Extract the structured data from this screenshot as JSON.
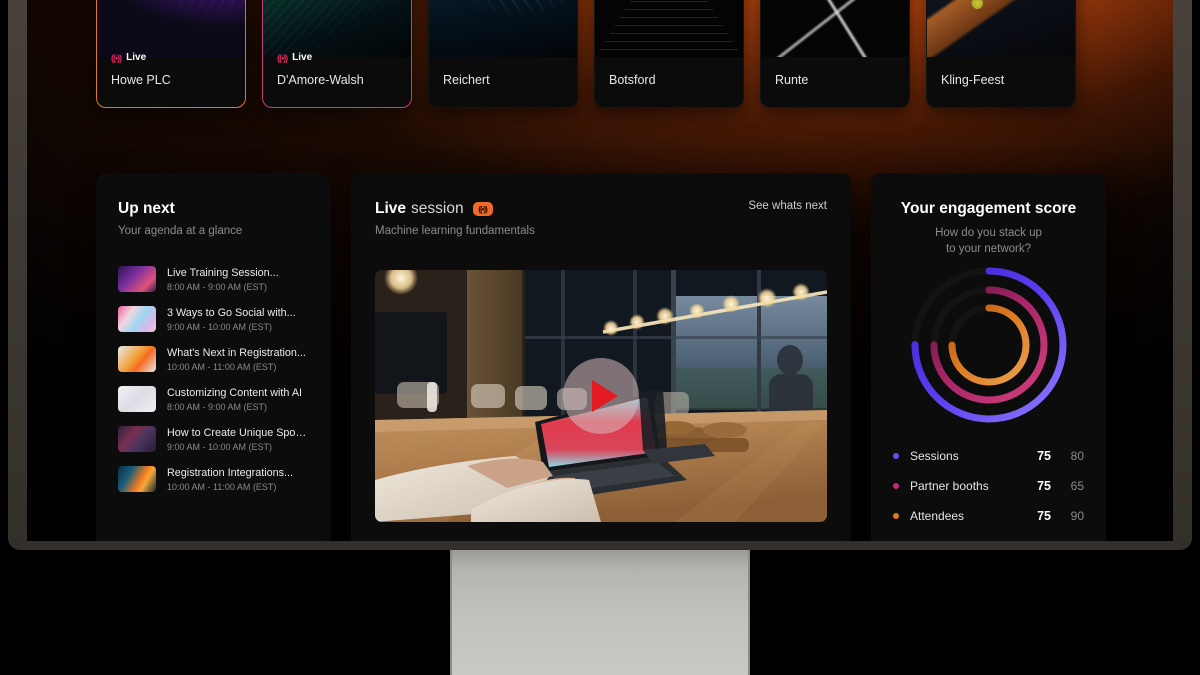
{
  "event_cards": [
    {
      "name": "Howe PLC",
      "live": true,
      "live_label": "Live",
      "avatar_icon": "glasses-face-icon",
      "highlight": "orange"
    },
    {
      "name": "D'Amore-Walsh",
      "live": true,
      "live_label": "Live",
      "avatar_icon": "bird-icon",
      "highlight": "pink"
    },
    {
      "name": "Reichert",
      "live": false,
      "live_label": "",
      "avatar_icon": "star-icon",
      "highlight": "none"
    },
    {
      "name": "Botsford",
      "live": false,
      "live_label": "",
      "avatar_icon": "leaf-icon",
      "highlight": "none"
    },
    {
      "name": "Runte",
      "live": false,
      "live_label": "",
      "avatar_icon": "smile-icon",
      "highlight": "none"
    },
    {
      "name": "Kling-Feest",
      "live": false,
      "live_label": "",
      "avatar_icon": "circle-icon",
      "highlight": "none"
    }
  ],
  "up_next": {
    "title": "Up next",
    "subtitle": "Your agenda at a glance",
    "items": [
      {
        "title": "Live Training Session...",
        "time": "8:00 AM - 9:00 AM (EST)"
      },
      {
        "title": "3 Ways to Go Social with...",
        "time": "9:00 AM - 10:00 AM (EST)"
      },
      {
        "title": "What's Next in Registration...",
        "time": "10:00 AM - 11:00 AM (EST)"
      },
      {
        "title": "Customizing Content with AI",
        "time": "8:00 AM - 9:00 AM (EST)"
      },
      {
        "title": "How to Create Unique Spon...",
        "time": "9:00 AM - 10:00 AM (EST)"
      },
      {
        "title": "Registration Integrations...",
        "time": "10:00 AM - 11:00 AM (EST)"
      }
    ]
  },
  "live_session": {
    "title_strong": "Live",
    "title_rest": "session",
    "badge_icon": "broadcast-icon",
    "subtitle": "Machine learning fundamentals",
    "see_next_label": "See whats next",
    "play_icon": "play-icon"
  },
  "engagement": {
    "title": "Your engagement score",
    "subtitle_line1": "How do you stack up",
    "subtitle_line2": "to your network?",
    "metrics": [
      {
        "label": "Sessions",
        "value": "75",
        "max": "80",
        "color": "#6c4cf0"
      },
      {
        "label": "Partner booths",
        "value": "75",
        "max": "65",
        "color": "#c02a7a"
      },
      {
        "label": "Attendees",
        "value": "75",
        "max": "90",
        "color": "#e07a26"
      }
    ]
  },
  "chart_data": {
    "type": "pie",
    "title": "Your engagement score",
    "subtitle": "How do you stack up to your network?",
    "categories": [
      "Sessions",
      "Partner booths",
      "Attendees"
    ],
    "values": [
      75,
      75,
      75
    ],
    "maxima": [
      80,
      65,
      90
    ],
    "colors": [
      "#6c4cf0",
      "#c02a7a",
      "#e07a26"
    ],
    "legend": "bottom",
    "rings": [
      {
        "name": "Sessions",
        "radius": "outer",
        "pct": 75,
        "color": "#6c4cf0"
      },
      {
        "name": "Partner booths",
        "radius": "middle",
        "pct": 75,
        "color": "#c02a7a"
      },
      {
        "name": "Attendees",
        "radius": "inner",
        "pct": 75,
        "color": "#e07a26"
      }
    ]
  }
}
